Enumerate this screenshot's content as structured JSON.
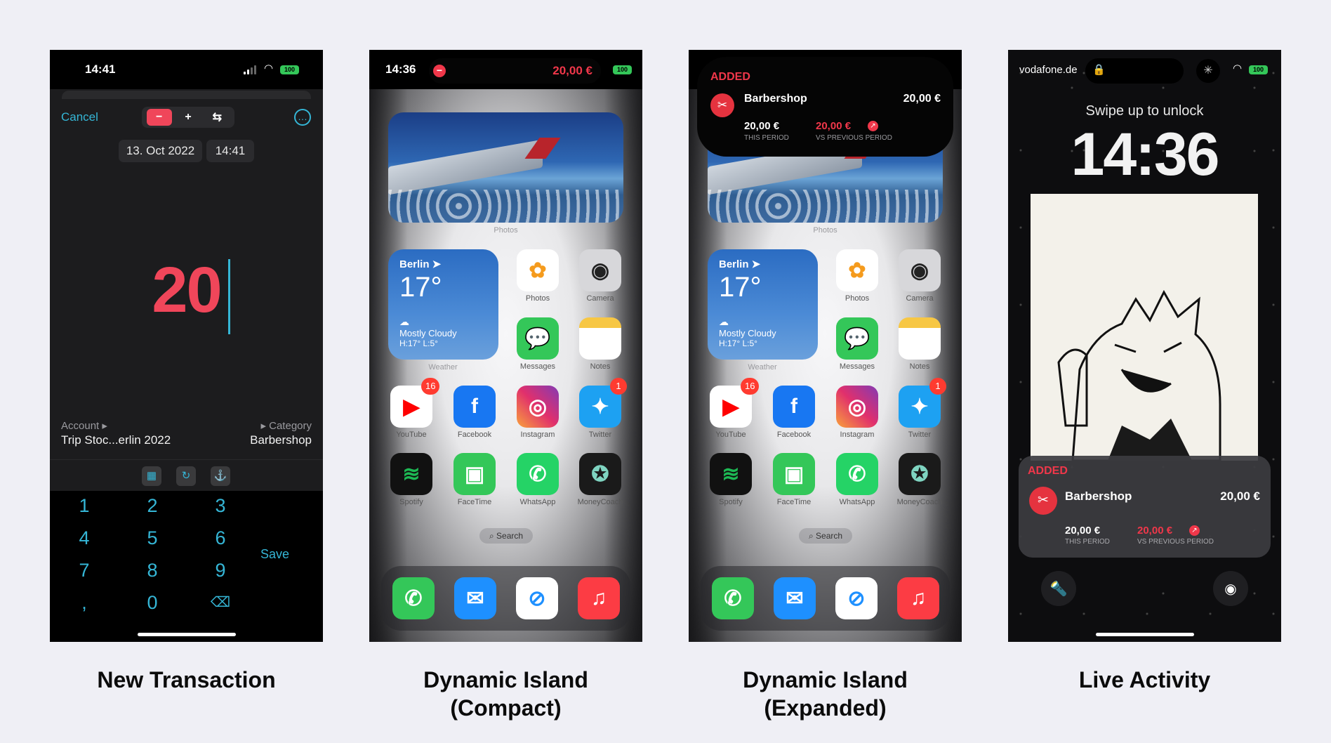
{
  "captions": [
    "New Transaction",
    "Dynamic Island\n(Compact)",
    "Dynamic Island\n(Expanded)",
    "Live Activity"
  ],
  "transaction": {
    "time": "14:41",
    "battery": "100",
    "cancel": "Cancel",
    "date": "13. Oct 2022",
    "clock": "14:41",
    "amount": "20",
    "account_label": "Account ▸",
    "account_value": "Trip Stoc...erlin 2022",
    "category_label": "▸ Category",
    "category_value": "Barbershop",
    "keys": [
      "1",
      "2",
      "3",
      "4",
      "5",
      "6",
      "7",
      "8",
      "9",
      ",",
      "0"
    ],
    "save": "Save",
    "colors": {
      "accent": "#35b6d6",
      "amount": "#f0465a"
    }
  },
  "compact": {
    "time": "14:36",
    "battery": "100",
    "island_amount": "20,00 €"
  },
  "expanded": {
    "added": "ADDED",
    "merchant": "Barbershop",
    "amount": "20,00 €",
    "this_value": "20,00 €",
    "this_label": "THIS PERIOD",
    "prev_value": "20,00 €",
    "prev_label": "VS PREVIOUS PERIOD"
  },
  "home": {
    "photos_widget": "Photos",
    "weather": {
      "city": "Berlin ➤",
      "temp": "17°",
      "cond": "Mostly Cloudy",
      "hl": "H:17° L:5°",
      "label": "Weather"
    },
    "apps": [
      {
        "name": "Photos",
        "icon": "photos-icon"
      },
      {
        "name": "Camera",
        "icon": "camera-icon"
      },
      {
        "name": "Messages",
        "icon": "messages-icon"
      },
      {
        "name": "Notes",
        "icon": "notes-icon"
      },
      {
        "name": "YouTube",
        "icon": "youtube-icon",
        "badge": "16"
      },
      {
        "name": "Facebook",
        "icon": "facebook-icon"
      },
      {
        "name": "Instagram",
        "icon": "instagram-icon"
      },
      {
        "name": "Twitter",
        "icon": "twitter-icon",
        "badge": "1"
      },
      {
        "name": "Spotify",
        "icon": "spotify-icon"
      },
      {
        "name": "FaceTime",
        "icon": "facetime-icon"
      },
      {
        "name": "WhatsApp",
        "icon": "whatsapp-icon"
      },
      {
        "name": "MoneyCoach",
        "icon": "moneycoach-icon"
      }
    ],
    "search": "Search",
    "dock": [
      "phone-icon",
      "mail-icon",
      "safari-icon",
      "music-icon"
    ]
  },
  "lockscreen": {
    "carrier": "vodafone.de",
    "battery": "100",
    "swipe": "Swipe up to unlock",
    "time": "14:36",
    "added": "ADDED",
    "merchant": "Barbershop",
    "amount": "20,00 €",
    "this_value": "20,00 €",
    "this_label": "THIS PERIOD",
    "prev_value": "20,00 €",
    "prev_label": "VS PREVIOUS PERIOD"
  }
}
